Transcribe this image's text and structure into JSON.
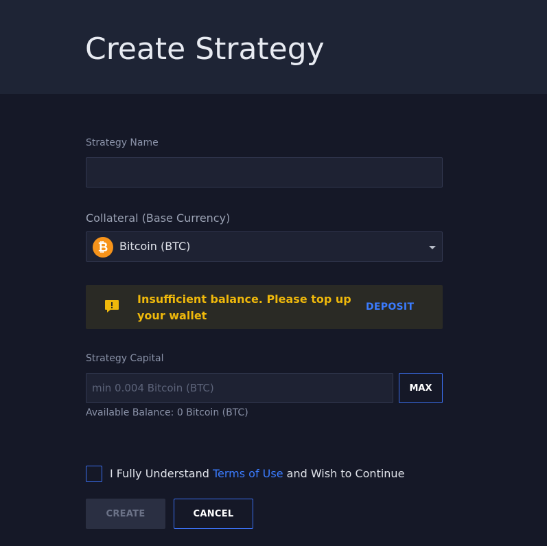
{
  "header": {
    "title": "Create Strategy"
  },
  "form": {
    "strategy_name": {
      "label": "Strategy Name",
      "value": ""
    },
    "collateral": {
      "label": "Collateral (Base Currency)",
      "selected": "Bitcoin (BTC)",
      "icon": "bitcoin-icon",
      "icon_glyph": "₿",
      "icon_color": "#f7931a"
    },
    "alert": {
      "message": "Insufficient balance. Please top up your wallet",
      "action": "DEPOSIT",
      "color": "#f0b90b"
    },
    "capital": {
      "label": "Strategy Capital",
      "placeholder": "min 0.004 Bitcoin (BTC)",
      "max_label": "MAX",
      "available_balance": "Available Balance: 0 Bitcoin (BTC)"
    },
    "terms": {
      "prefix": "I Fully Understand ",
      "link": "Terms of Use",
      "suffix": " and Wish to Continue",
      "checked": false
    },
    "buttons": {
      "create": "CREATE",
      "cancel": "CANCEL"
    }
  },
  "colors": {
    "background": "#151827",
    "header": "#1e2435",
    "accent": "#3b6ff0",
    "link": "#3b7cff",
    "warning": "#f0b90b"
  }
}
